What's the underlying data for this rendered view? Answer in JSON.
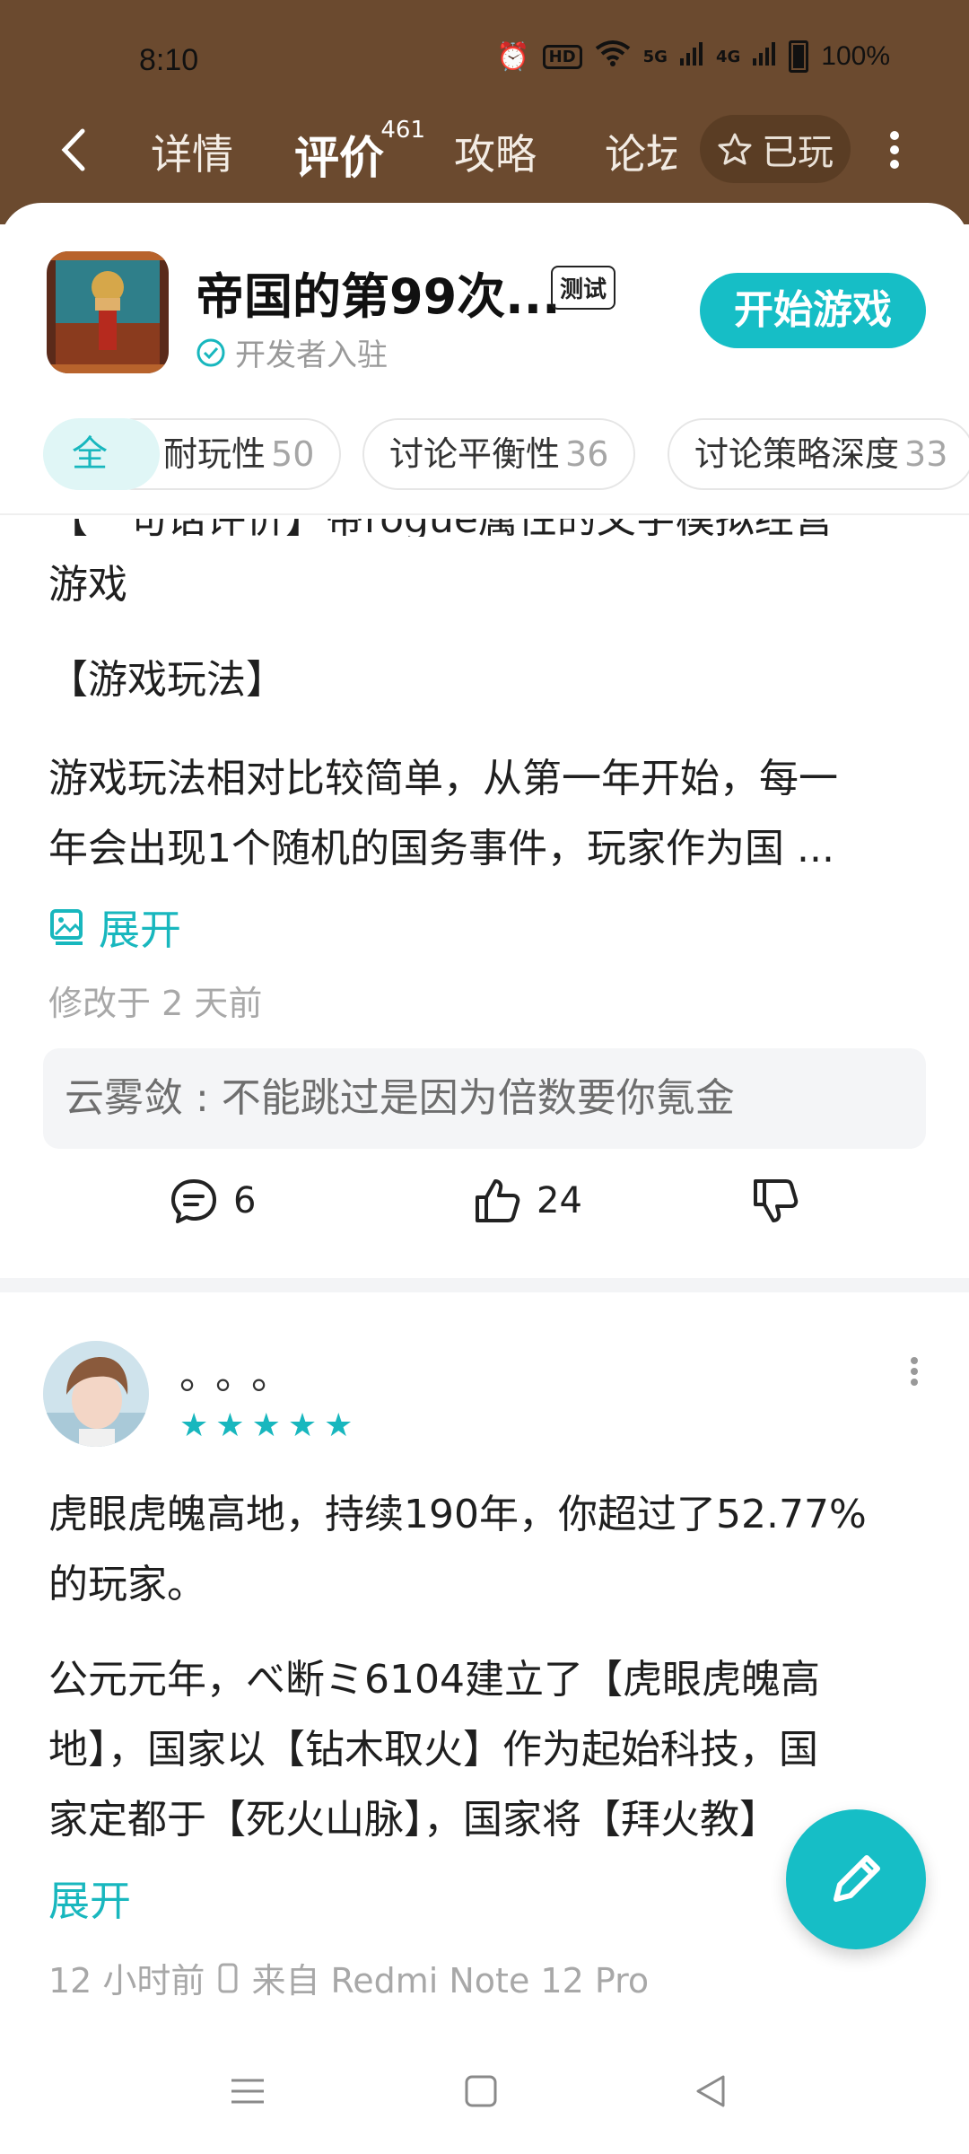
{
  "status_bar": {
    "time": "8:10",
    "net1": "5G",
    "net2": "4G",
    "hd": "HD",
    "battery": "100%"
  },
  "nav": {
    "tabs": [
      {
        "label": "详情"
      },
      {
        "label": "评价",
        "count": "461"
      },
      {
        "label": "攻略"
      },
      {
        "label": "论坛"
      }
    ],
    "played_label": "已玩"
  },
  "game": {
    "title": "帝国的第99次...",
    "badge": "测试",
    "dev_label": "开发者入驻",
    "start_label": "开始游戏"
  },
  "filters": {
    "all": "全",
    "chips": [
      {
        "label": "耐玩性",
        "count": "50"
      },
      {
        "label": "讨论平衡性",
        "count": "36"
      },
      {
        "label": "讨论策略深度",
        "count": "33"
      }
    ]
  },
  "review1": {
    "line_partial": "【一句话评价】带rogue属性的文字模拟经营",
    "line_cont": "游戏",
    "section": "【游戏玩法】",
    "body1": "游戏玩法相对比较简单，从第一年开始，每一",
    "body2": "年会出现1个随机的国务事件，玩家作为国 ...",
    "expand": "展开",
    "modified": "修改于 2 天前",
    "reply": "云雾敛 : 不能跳过是因为倍数要你氪金",
    "comments": "6",
    "likes": "24"
  },
  "review2": {
    "username": "。。。",
    "rating": 5,
    "line1": "虎眼虎魄高地，持续190年，你超过了52.77%",
    "line2": "的玩家。",
    "para1": "公元元年，べ断ミ6104建立了【虎眼虎魄高",
    "para2": "地】，国家以【钻木取火】作为起始科技，国",
    "para3": "家定都于【死火山脉】，国家将【拜火教】",
    "expand": "展开",
    "time": "12 小时前",
    "device": "来自 Redmi Note 12 Pro"
  },
  "colors": {
    "accent": "#16bec6",
    "header": "#6b4a2f"
  }
}
